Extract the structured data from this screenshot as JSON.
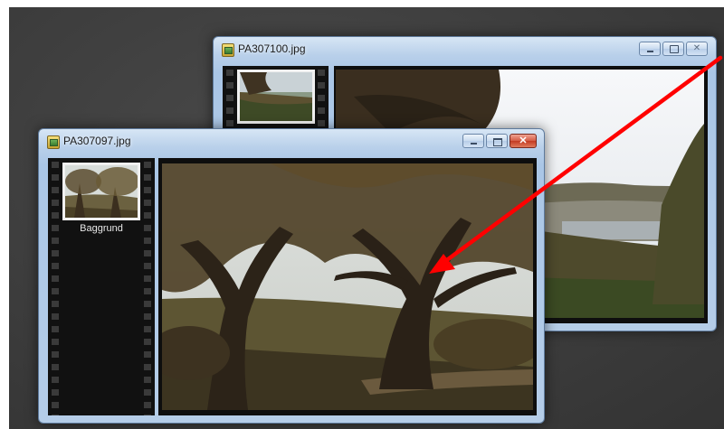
{
  "back_window": {
    "title": "PA307100.jpg",
    "controls": [
      "minimize",
      "restore",
      "close"
    ]
  },
  "front_window": {
    "title": "PA307097.jpg",
    "controls": [
      "minimize",
      "maximize",
      "close"
    ],
    "thumbnail_label": "Baggrund"
  },
  "annotation": {
    "arrow_color": "#ff0000"
  }
}
